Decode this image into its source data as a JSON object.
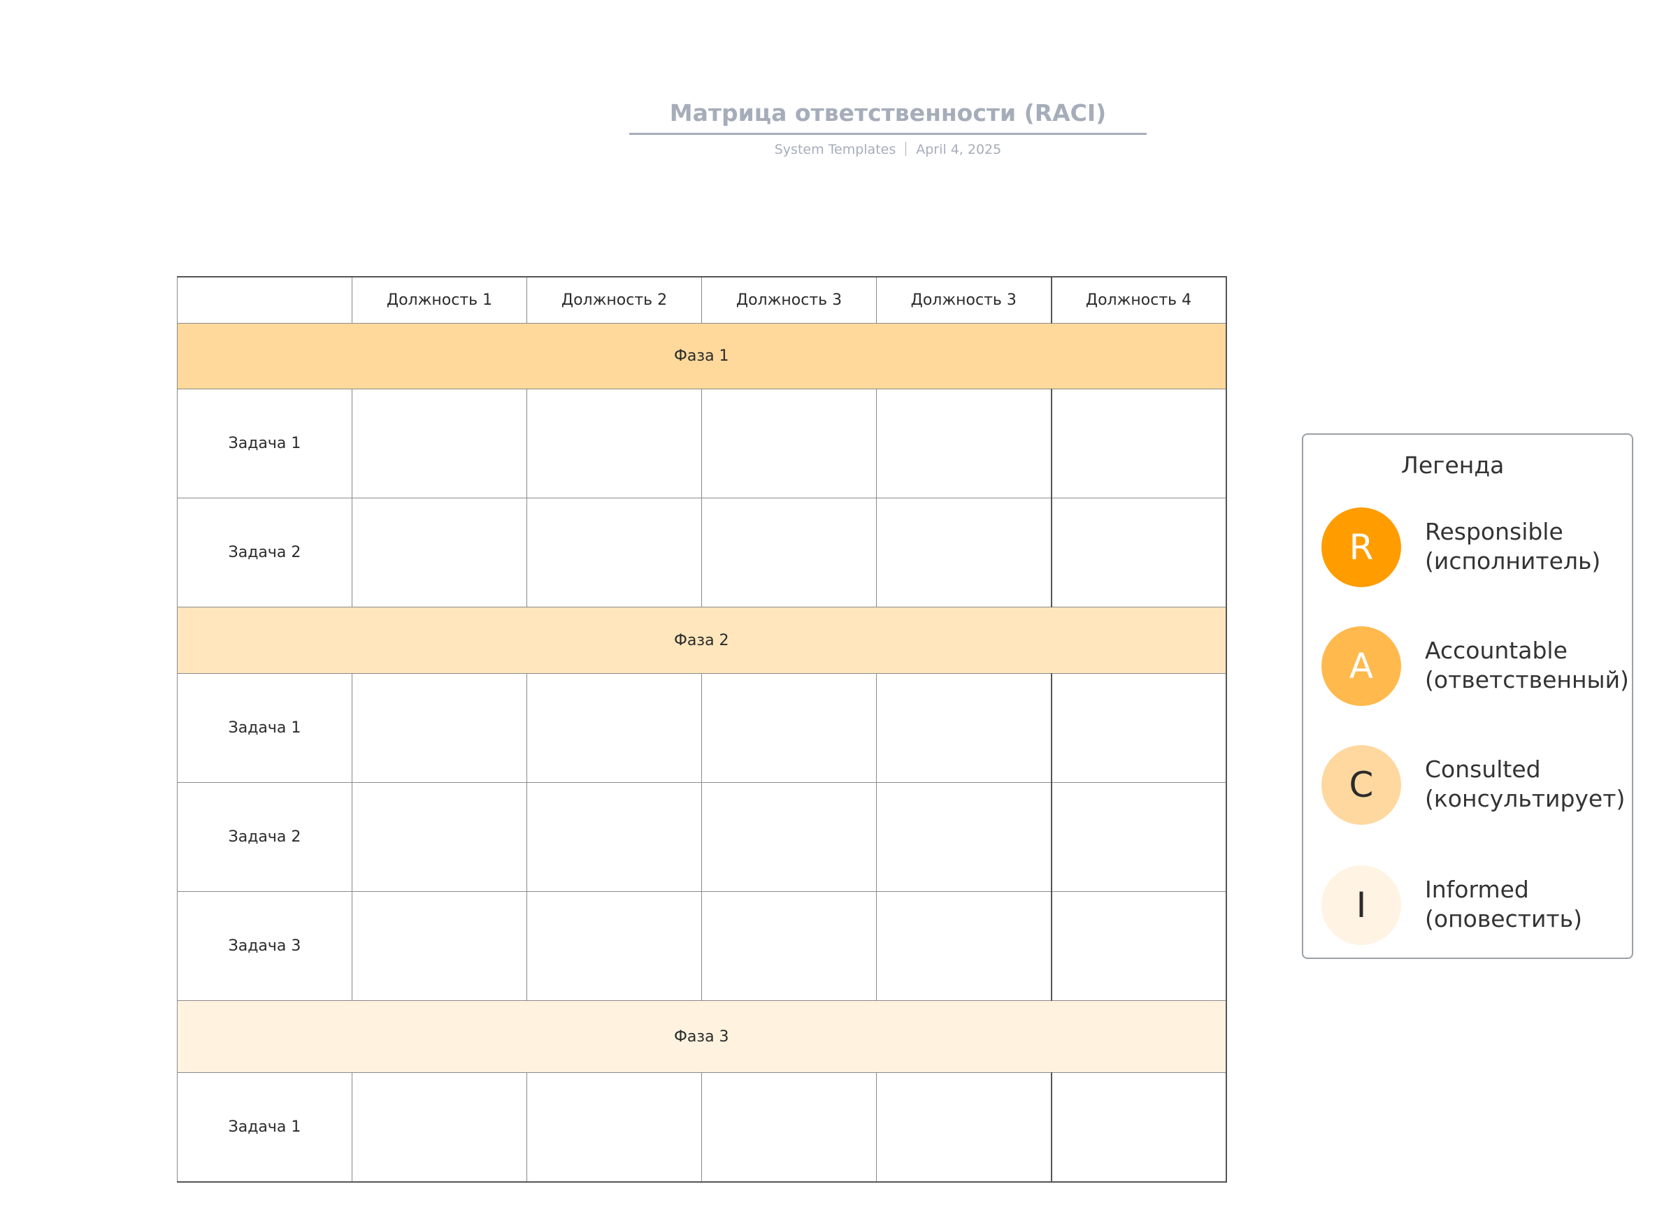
{
  "header": {
    "title": "Матрица ответственности (RACI)",
    "source": "System Templates",
    "date": "April 4, 2025"
  },
  "matrix": {
    "roles": [
      "Должность 1",
      "Должность 2",
      "Должность 3",
      "Должность 3",
      "Должность 4"
    ],
    "phases": [
      {
        "label": "Фаза 1",
        "tasks": [
          "Задача 1",
          "Задача 2"
        ]
      },
      {
        "label": "Фаза 2",
        "tasks": [
          "Задача 1",
          "Задача 2",
          "Задача 3"
        ]
      },
      {
        "label": "Фаза 3",
        "tasks": [
          "Задача 1"
        ]
      }
    ]
  },
  "legend": {
    "title": "Легенда",
    "items": [
      {
        "letter": "R",
        "name": "Responsible",
        "desc": "(исполнитель)",
        "color": "#ff9c00",
        "text_color": "#ffffff"
      },
      {
        "letter": "A",
        "name": "Accountable",
        "desc": "(ответственный)",
        "color": "#ffb94d",
        "text_color": "#ffffff"
      },
      {
        "letter": "C",
        "name": "Consulted",
        "desc": "(консультирует)",
        "color": "#ffd89f",
        "text_color": "#2b2b2b"
      },
      {
        "letter": "I",
        "name": "Informed",
        "desc": "(оповестить)",
        "color": "#fff3e3",
        "text_color": "#2b2b2b"
      }
    ]
  }
}
